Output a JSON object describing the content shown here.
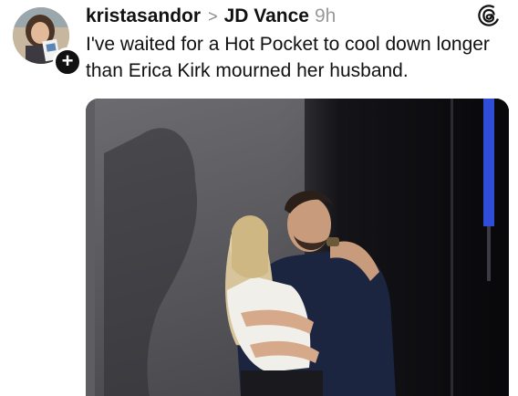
{
  "post": {
    "username": "kristasandor",
    "reply_chevron": ">",
    "reply_to": "JD Vance",
    "timestamp": "9h",
    "text": "I've waited for a Hot Pocket to cool down longer than Erica Kirk mourned her husband.",
    "follow_badge": "+"
  },
  "icons": {
    "app_logo": "threads-icon",
    "follow": "plus-icon"
  },
  "colors": {
    "text": "#111111",
    "muted": "#9a9a9a",
    "stage_light": "#2f4dd8"
  }
}
